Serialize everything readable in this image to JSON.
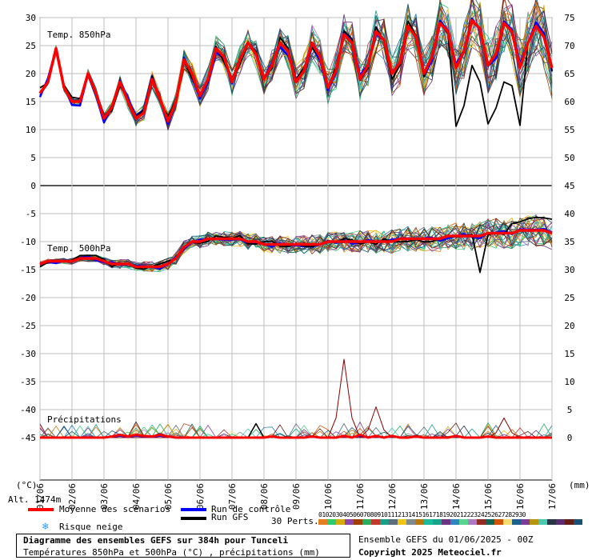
{
  "header": {
    "title": "Diagramme des ensembles GEFS sur 384h pour Tunceli",
    "subtitle": "Températures 850hPa et 500hPa (°C) , précipitations (mm)",
    "run_info": "Ensemble GEFS du 01/06/2025 - 00Z",
    "copyright": "Copyright 2025 Meteociel.fr",
    "altitude": "Alt. 1474m"
  },
  "axis": {
    "left_unit": "(°C)",
    "right_unit": "(mm)",
    "left_ticks": [
      30,
      25,
      20,
      15,
      10,
      5,
      0,
      -5,
      -10,
      -15,
      -20,
      -25,
      -30,
      -35,
      -40,
      -45
    ],
    "right_ticks": [
      75,
      70,
      65,
      60,
      55,
      50,
      45,
      40,
      35,
      30,
      25,
      20,
      15,
      10,
      5,
      0
    ],
    "dates": [
      "01/06",
      "02/06",
      "03/06",
      "04/06",
      "05/06",
      "06/06",
      "07/06",
      "08/06",
      "09/06",
      "10/06",
      "11/06",
      "12/06",
      "13/06",
      "14/06",
      "15/06",
      "16/06",
      "17/06"
    ]
  },
  "panel_labels": {
    "t850": "Temp. 850hPa",
    "t500": "Temp. 500hPa",
    "precip": "Précipitations"
  },
  "legend": {
    "mean": "Moyenne des scénarios",
    "control": "Run de contrôle",
    "gfs": "Run GFS",
    "snow": "Risque neige",
    "perts": "30 Perts.",
    "mean_color": "#ff0000",
    "control_color": "#0000ff",
    "gfs_color": "#000000",
    "pert_numbers": [
      "01",
      "02",
      "03",
      "04",
      "05",
      "06",
      "07",
      "08",
      "09",
      "10",
      "11",
      "12",
      "13",
      "14",
      "15",
      "16",
      "17",
      "18",
      "19",
      "20",
      "21",
      "22",
      "23",
      "24",
      "25",
      "26",
      "27",
      "28",
      "29",
      "30"
    ],
    "pert_colors": [
      "#e67e22",
      "#2ecc71",
      "#d4ac0d",
      "#8e44ad",
      "#a04000",
      "#27ae60",
      "#c0392b",
      "#16a085",
      "#5d6d7e",
      "#f1c40f",
      "#7f8c8d",
      "#b9770e",
      "#1abc9c",
      "#17a589",
      "#6c3483",
      "#2e86c1",
      "#58d68d",
      "#af7ac5",
      "#922b21",
      "#0e6655",
      "#d35400",
      "#f7dc6f",
      "#1f618d",
      "#7d3c98",
      "#b7950b",
      "#48c9b0",
      "#283747",
      "#5b2c6f",
      "#641e16",
      "#1a5276"
    ]
  },
  "chart_data": {
    "type": "line",
    "x": [
      "01/06",
      "02/06",
      "03/06",
      "04/06",
      "05/06",
      "06/06",
      "07/06",
      "08/06",
      "09/06",
      "10/06",
      "11/06",
      "12/06",
      "13/06",
      "14/06",
      "15/06",
      "16/06",
      "17/06"
    ],
    "x_step_hours": 6,
    "t850": {
      "ylim": [
        0,
        30
      ],
      "mean": [
        16.5,
        18.5,
        24.5,
        17.5,
        15,
        15,
        20,
        16.5,
        12,
        14,
        18.5,
        15,
        12,
        13,
        19,
        15.5,
        11.5,
        15,
        22.5,
        20,
        16,
        19,
        24.5,
        23,
        18.5,
        22.5,
        25.5,
        23.5,
        19,
        21.5,
        25.5,
        24,
        18.5,
        20.5,
        25.5,
        23,
        17.5,
        20.5,
        27,
        25.5,
        19,
        21.5,
        27.5,
        26,
        20,
        22,
        28.5,
        26.5,
        20,
        23,
        29,
        27.5,
        21,
        24,
        29.5,
        28,
        21.5,
        23.5,
        29,
        27.5,
        21,
        25.5,
        28.5,
        26.5,
        21
      ]
    },
    "t500": {
      "ylim": [
        -45,
        0
      ],
      "mean": [
        -14,
        -13.5,
        -13.5,
        -13.5,
        -13.5,
        -13,
        -13,
        -13,
        -13.5,
        -14,
        -14,
        -14,
        -14.5,
        -14.5,
        -14.5,
        -14.5,
        -14,
        -13,
        -11,
        -10,
        -10,
        -9.5,
        -9.5,
        -9.5,
        -9.5,
        -9.5,
        -10,
        -10,
        -10.5,
        -10.5,
        -10.5,
        -10.5,
        -10.5,
        -10.5,
        -10.5,
        -10.5,
        -10,
        -10,
        -10,
        -10,
        -10,
        -10,
        -10,
        -10,
        -10,
        -9.5,
        -9.5,
        -9.5,
        -9.5,
        -9.5,
        -9.5,
        -9,
        -9,
        -9,
        -9,
        -9,
        -8.5,
        -8.5,
        -8.5,
        -8.5,
        -8,
        -8,
        -8,
        -8,
        -8.5
      ]
    },
    "precip": {
      "ylim": [
        0,
        45
      ],
      "mean": [
        0,
        0,
        0,
        0,
        0,
        0,
        0,
        0,
        0,
        0.2,
        0.5,
        0.2,
        0.5,
        0.3,
        0.2,
        0.5,
        0.2,
        0,
        0,
        0,
        0,
        0,
        0,
        0,
        0,
        0,
        0,
        0,
        0,
        0.2,
        0,
        0,
        0,
        0,
        0.2,
        0,
        0,
        0,
        0.3,
        0,
        0.5,
        0,
        0.3,
        0,
        0.3,
        0,
        0,
        0.2,
        0,
        0,
        0,
        0,
        0.3,
        0,
        0,
        0,
        0.2,
        0,
        0,
        0,
        0,
        0,
        0,
        0,
        0
      ],
      "peaks": [
        {
          "x": "10/06",
          "value": 14
        },
        {
          "x": "11/06",
          "value": 5.5
        },
        {
          "x": "15/06",
          "value": 3.5
        }
      ]
    }
  }
}
